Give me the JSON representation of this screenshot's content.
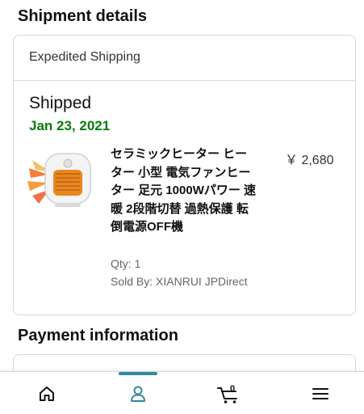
{
  "shipment": {
    "section_title": "Shipment details",
    "shipping_method": "Expedited Shipping",
    "status": "Shipped",
    "date": "Jan 23, 2021",
    "item": {
      "title": "セラミックヒーター ヒーター 小型 電気ファンヒーター 足元 1000Wパワー 速暖 2段階切替 過熱保護 転倒電源OFF機",
      "price": "￥ 2,680",
      "qty": "Qty: 1",
      "seller": "Sold By: XIANRUI JPDirect"
    }
  },
  "payment": {
    "section_title": "Payment information"
  },
  "nav": {
    "items": [
      {
        "icon": "home-icon"
      },
      {
        "icon": "account-icon",
        "active": true
      },
      {
        "icon": "cart-icon",
        "count": "0"
      },
      {
        "icon": "menu-icon"
      }
    ]
  },
  "colors": {
    "date_green": "#067d0a",
    "accent_teal": "#2f8a9b",
    "border": "#d5d9d9"
  }
}
